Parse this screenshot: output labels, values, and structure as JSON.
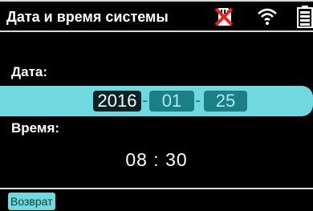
{
  "header": {
    "title": "Дата и время системы",
    "icons": [
      "sd-card-error-icon",
      "wifi-icon",
      "battery-icon"
    ]
  },
  "date": {
    "label": "Дата:",
    "year": "2016",
    "month": "01",
    "day": "25",
    "separator": "-"
  },
  "time": {
    "label": "Время:",
    "value": "08 : 30"
  },
  "footer": {
    "back_label": "Возврат"
  },
  "colors": {
    "background": "#000000",
    "accent": "#6fd9df",
    "selected_segment": "#0b2224",
    "segment": "#1d7f86",
    "error_red": "#e32222"
  }
}
